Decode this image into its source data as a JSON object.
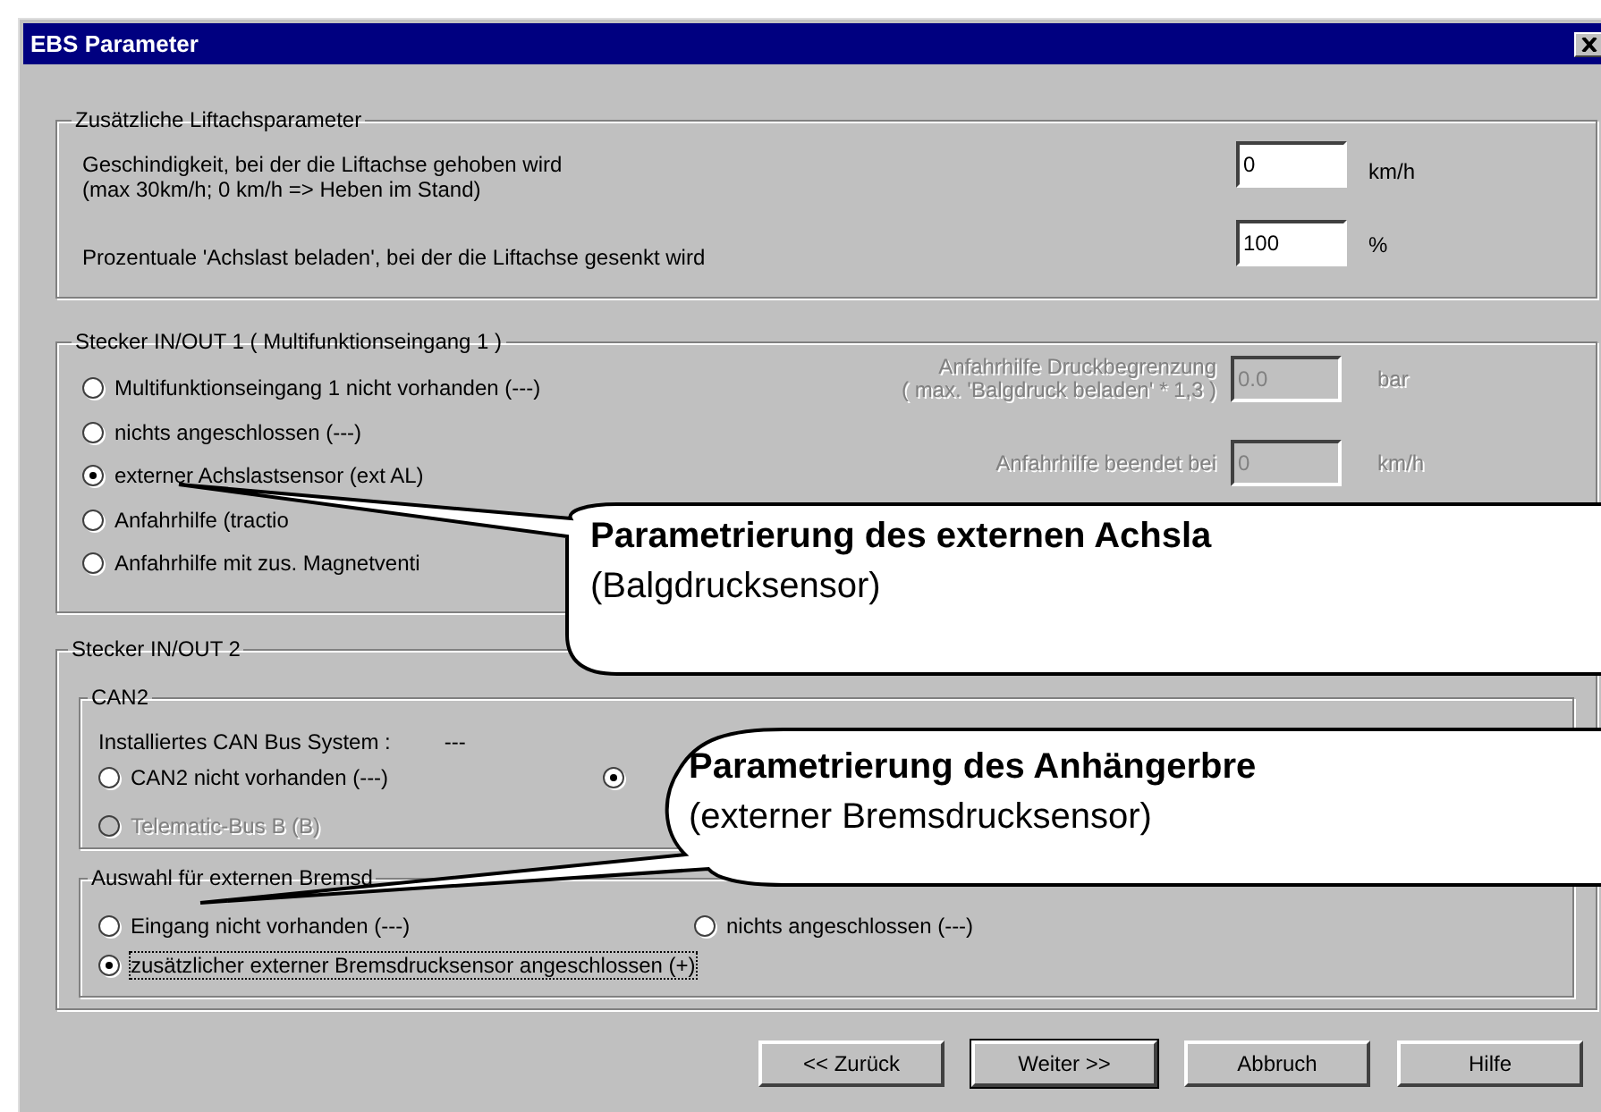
{
  "window": {
    "title": "EBS Parameter"
  },
  "liftaxle_group": {
    "legend": "Zusätzliche Liftachsparameter",
    "rows": [
      {
        "label": "Geschindigkeit, bei der die Liftachse gehoben wird",
        "label_2": "(max 30km/h; 0 km/h => Heben im Stand)",
        "value": "0",
        "unit": "km/h"
      },
      {
        "label": "Prozentuale 'Achslast beladen', bei der die Liftachse gesenkt wird",
        "value": "100",
        "unit": "%"
      }
    ]
  },
  "connector_1": {
    "legend": "Stecker IN/OUT 1 ( Multifunktionseingang 1 )",
    "options": [
      {
        "label": "Multifunktionseingang 1 nicht vorhanden (---)",
        "selected": false
      },
      {
        "label": "nichts angeschlossen (---)",
        "selected": false
      },
      {
        "label": "externer Achslastsensor (ext AL)",
        "selected": true
      },
      {
        "label": "Anfahrhilfe (tractio",
        "selected": false
      },
      {
        "label": "Anfahrhilfe mit zus. Magnetventi",
        "selected": false
      }
    ],
    "fields": [
      {
        "label": "Anfahrhilfe Druckbegrenzung",
        "label_2": "( max. 'Balgdruck beladen' * 1,3 )",
        "value": "0.0",
        "unit": "bar",
        "disabled": true
      },
      {
        "label": "Anfahrhilfe beendet bei",
        "value": "0",
        "unit": "km/h",
        "disabled": true
      }
    ]
  },
  "connector_2": {
    "legend": "Stecker IN/OUT 2",
    "can2": {
      "legend": "CAN2",
      "bus_label": "Installiertes CAN Bus System :",
      "bus_value": "---",
      "options": [
        {
          "label": "CAN2 nicht vorhanden (---)",
          "selected": false,
          "disabled": false
        },
        {
          "selected": true,
          "disabled": false
        },
        {
          "label": "Telematic-Bus B (B)",
          "selected": false,
          "disabled": true
        }
      ]
    },
    "brake_sensor": {
      "legend": "Auswahl für externen Bremsd",
      "options": [
        {
          "label": "Eingang nicht vorhanden (---)",
          "selected": false,
          "focused": false
        },
        {
          "label": "nichts angeschlossen (---)",
          "selected": false,
          "focused": false
        },
        {
          "label": "zusätzlicher externer Bremsdrucksensor angeschlossen (+)",
          "selected": true,
          "focused": true
        }
      ]
    }
  },
  "buttons": [
    {
      "label": "<< Zurück",
      "default": false
    },
    {
      "label": "Weiter >>",
      "default": true
    },
    {
      "label": "Abbruch",
      "default": false
    },
    {
      "label": "Hilfe",
      "default": false
    }
  ],
  "callouts": [
    {
      "title": "Parametrierung des externen Achsla",
      "subtitle": "(Balgdrucksensor)"
    },
    {
      "title": "Parametrierung des Anhängerbre",
      "subtitle": "(externer Bremsdrucksensor)"
    }
  ]
}
